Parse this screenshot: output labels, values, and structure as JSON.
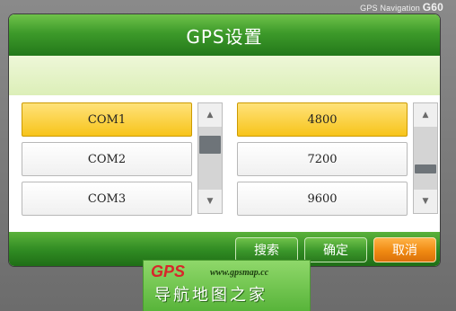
{
  "brand": {
    "prefix": "GPS Navigation ",
    "model": "G60"
  },
  "title": "GPS设置",
  "ports": {
    "items": [
      "COM1",
      "COM2",
      "COM3"
    ],
    "selected": "COM1"
  },
  "baud_rates": {
    "items": [
      "4800",
      "7200",
      "9600"
    ],
    "selected": "4800"
  },
  "scroll_icons": {
    "up": "scroll-up-arrow-icon",
    "down": "scroll-down-arrow-icon"
  },
  "buttons": {
    "search": "搜索",
    "confirm": "确定",
    "cancel": "取消"
  },
  "watermark": {
    "logo": "GPS",
    "url": "www.gpsmap.cc",
    "text": "导航地图之家"
  },
  "colors": {
    "title_green": "#3d9a2a",
    "selected_yellow": "#f7c41a",
    "cancel_orange": "#f08a12"
  }
}
